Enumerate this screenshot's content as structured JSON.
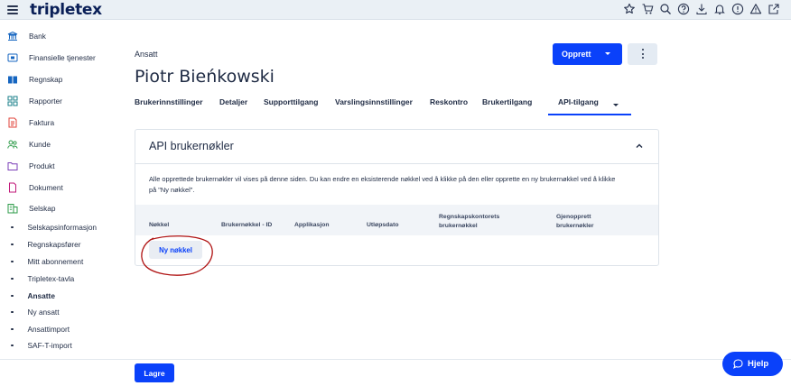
{
  "app": {
    "logo": "tripletex"
  },
  "topbar": {
    "icons": [
      "star-icon",
      "cart-icon",
      "search-icon",
      "help-circle-icon",
      "download-icon",
      "bell-icon",
      "alert-circle-icon",
      "warning-icon",
      "external-link-icon"
    ]
  },
  "sidebar": {
    "items": [
      {
        "label": "Bank",
        "icon": "bank-icon"
      },
      {
        "label": "Finansielle tjenester",
        "icon": "card-icon"
      },
      {
        "label": "Regnskap",
        "icon": "book-icon"
      },
      {
        "label": "Rapporter",
        "icon": "grid-icon"
      },
      {
        "label": "Faktura",
        "icon": "invoice-icon"
      },
      {
        "label": "Kunde",
        "icon": "people-icon"
      },
      {
        "label": "Produkt",
        "icon": "folder-icon"
      },
      {
        "label": "Dokument",
        "icon": "document-icon"
      },
      {
        "label": "Selskap",
        "icon": "building-icon"
      }
    ],
    "subitems": [
      {
        "label": "Selskapsinformasjon"
      },
      {
        "label": "Regnskapsfører"
      },
      {
        "label": "Mitt abonnement"
      },
      {
        "label": "Tripletex-tavla"
      },
      {
        "label": "Ansatte",
        "active": true
      },
      {
        "label": "Ny ansatt"
      },
      {
        "label": "Ansattimport"
      },
      {
        "label": "SAF-T-import"
      }
    ]
  },
  "header": {
    "section": "Ansatt",
    "title": "Piotr Bieńkowski",
    "create_label": "Opprett"
  },
  "tabs": [
    {
      "label": "Brukerinnstillinger"
    },
    {
      "label": "Detaljer"
    },
    {
      "label": "Supporttilgang"
    },
    {
      "label": "Varslingsinnstillinger"
    },
    {
      "label": "Reskontro"
    },
    {
      "label": "Brukertilgang"
    },
    {
      "label": "API-tilgang",
      "active": true
    }
  ],
  "card": {
    "title": "API brukernøkler",
    "description": "Alle opprettede brukernøkler vil vises på denne siden. Du kan endre en eksisterende nøkkel ved å klikke på den eller opprette en ny brukernøkkel ved å klikke på \"Ny nøkkel\".",
    "columns": [
      {
        "label": "Nøkkel"
      },
      {
        "label": "Brukernøkkel - ID"
      },
      {
        "label": "Applikasjon"
      },
      {
        "label": "Utløpsdato"
      },
      {
        "label": "Regnskapskontorets brukernøkkel"
      },
      {
        "label": "Gjenopprett brukernøkler"
      }
    ],
    "new_key_label": "Ny nøkkel"
  },
  "footer": {
    "save_label": "Lagre",
    "help_label": "Hjelp"
  },
  "colors": {
    "accent": "#0a41fa",
    "annotation": "#b01414",
    "topbar": "#eaf0f5"
  }
}
